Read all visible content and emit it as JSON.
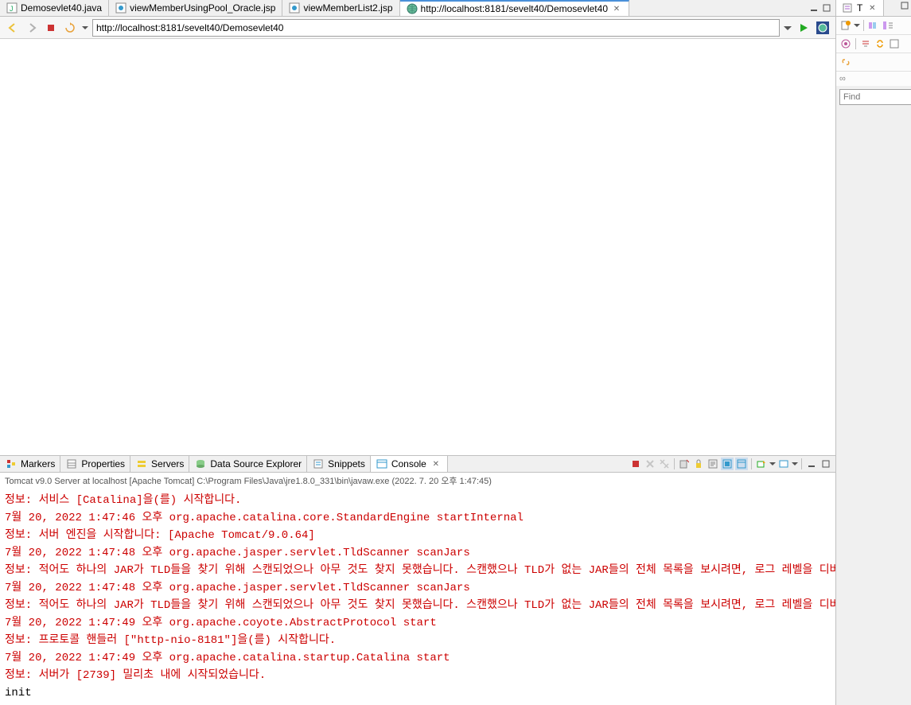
{
  "editor_tabs": [
    {
      "label": "Demosevlet40.java",
      "icon": "J"
    },
    {
      "label": "viewMemberUsingPool_Oracle.jsp",
      "icon": "jsp"
    },
    {
      "label": "viewMemberList2.jsp",
      "icon": "jsp"
    },
    {
      "label": "http://localhost:8181/sevelt40/Demosevlet40",
      "icon": "globe",
      "closable": true,
      "active": true
    }
  ],
  "close_glyph": "✕",
  "browser": {
    "url": "http://localhost:8181/sevelt40/Demosevlet40"
  },
  "bottom_tabs": [
    {
      "label": "Markers"
    },
    {
      "label": "Properties"
    },
    {
      "label": "Servers"
    },
    {
      "label": "Data Source Explorer"
    },
    {
      "label": "Snippets"
    },
    {
      "label": "Console",
      "closable": true,
      "active": true
    }
  ],
  "console_header": "Tomcat v9.0 Server at localhost [Apache Tomcat] C:\\Program Files\\Java\\jre1.8.0_331\\bin\\javaw.exe  (2022. 7. 20 오후 1:47:45)",
  "console_lines": [
    {
      "cls": "red",
      "text": "정보: 서비스 [Catalina]을(를) 시작합니다."
    },
    {
      "cls": "red",
      "text": "7월 20, 2022 1:47:46 오후 org.apache.catalina.core.StandardEngine startInternal"
    },
    {
      "cls": "red",
      "text": "정보: 서버 엔진을 시작합니다: [Apache Tomcat/9.0.64]"
    },
    {
      "cls": "red",
      "text": "7월 20, 2022 1:47:48 오후 org.apache.jasper.servlet.TldScanner scanJars"
    },
    {
      "cls": "red",
      "text": "정보: 적어도 하나의 JAR가 TLD들을 찾기 위해 스캔되었으나 아무 것도 찾지 못했습니다. 스캔했으나 TLD가 없는 JAR들의 전체 목록을 보시려면, 로그 레벨을 디버"
    },
    {
      "cls": "red",
      "text": "7월 20, 2022 1:47:48 오후 org.apache.jasper.servlet.TldScanner scanJars"
    },
    {
      "cls": "red",
      "text": "정보: 적어도 하나의 JAR가 TLD들을 찾기 위해 스캔되었으나 아무 것도 찾지 못했습니다. 스캔했으나 TLD가 없는 JAR들의 전체 목록을 보시려면, 로그 레벨을 디버"
    },
    {
      "cls": "red",
      "text": "7월 20, 2022 1:47:49 오후 org.apache.coyote.AbstractProtocol start"
    },
    {
      "cls": "red",
      "text": "정보: 프로토콜 핸들러 [\"http-nio-8181\"]을(를) 시작합니다."
    },
    {
      "cls": "red",
      "text": "7월 20, 2022 1:47:49 오후 org.apache.catalina.startup.Catalina start"
    },
    {
      "cls": "red",
      "text": "정보: 서버가 [2739] 밀리초 내에 시작되었습니다."
    },
    {
      "cls": "black",
      "text": "init"
    }
  ],
  "right_panel": {
    "tab_label": "T",
    "find_placeholder": "Find",
    "link_glyph": "∞"
  }
}
